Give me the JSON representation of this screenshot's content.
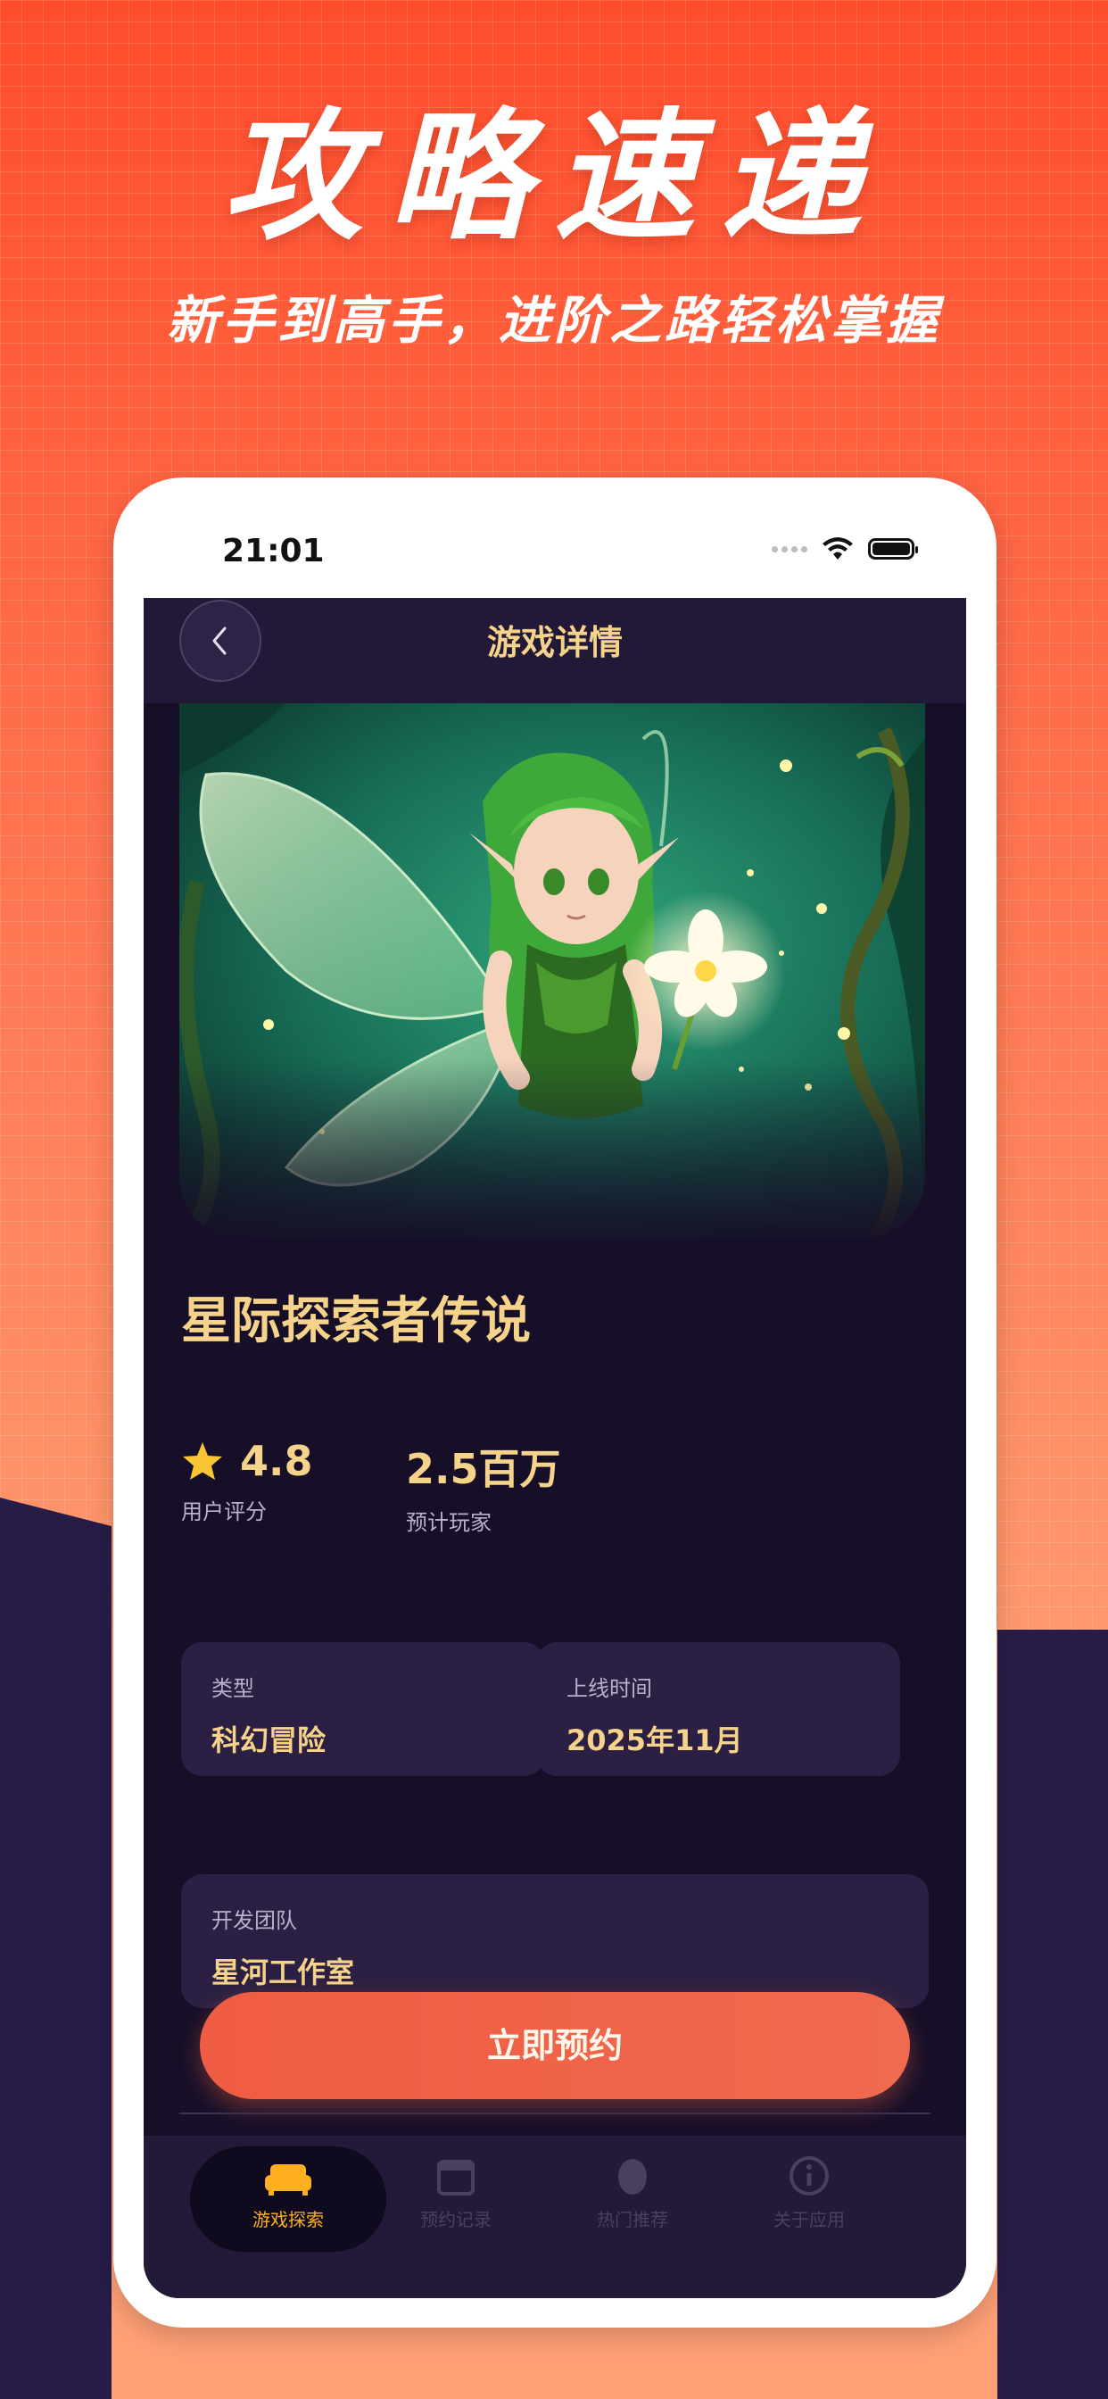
{
  "promo": {
    "headline": "攻略速递",
    "subheadline": "新手到高手，进阶之路轻松掌握"
  },
  "status_bar": {
    "time": "21:01"
  },
  "nav": {
    "title": "游戏详情"
  },
  "game": {
    "title": "星际探索者传说",
    "rating_value": "4.8",
    "rating_label": "用户评分",
    "players_value": "2.5百万",
    "players_label": "预计玩家",
    "genre_label": "类型",
    "genre_value": "科幻冒险",
    "release_label": "上线时间",
    "release_value": "2025年11月",
    "developer_label": "开发团队",
    "developer_value": "星河工作室"
  },
  "cta": {
    "label": "立即预约"
  },
  "tabbar": {
    "items": [
      {
        "label": "游戏探索",
        "icon": "sofa-icon",
        "active": true
      },
      {
        "label": "预约记录",
        "icon": "calendar-icon",
        "active": false
      },
      {
        "label": "热门推荐",
        "icon": "egg-icon",
        "active": false
      },
      {
        "label": "关于应用",
        "icon": "info-icon",
        "active": false
      }
    ]
  },
  "colors": {
    "accent_gold": "#f6d38a",
    "cta_orange": "#ee5c43",
    "screen_bg": "#170f28",
    "tab_active": "#ffb020",
    "tab_inactive": "#4a3f5f"
  }
}
